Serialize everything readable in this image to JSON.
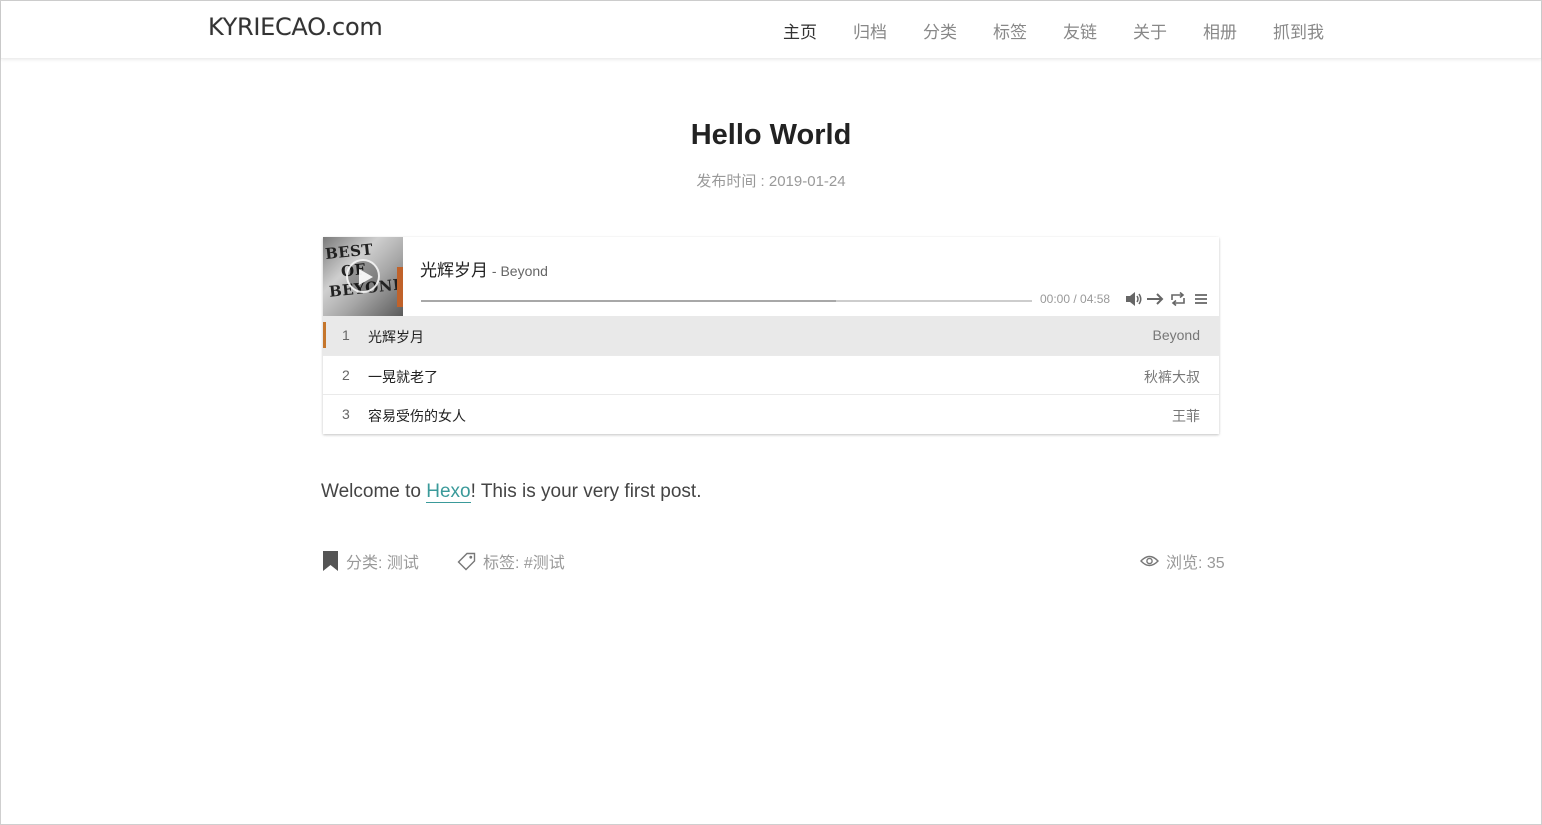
{
  "site": {
    "logo": "KYRIECAO.com"
  },
  "nav": {
    "items": [
      {
        "label": "主页",
        "active": true
      },
      {
        "label": "归档"
      },
      {
        "label": "分类"
      },
      {
        "label": "标签"
      },
      {
        "label": "友链"
      },
      {
        "label": "关于"
      },
      {
        "label": "相册"
      },
      {
        "label": "抓到我"
      }
    ]
  },
  "post": {
    "title": "Hello World",
    "meta": "发布时间 : 2019-01-24",
    "content_before": "Welcome to ",
    "content_link": "Hexo",
    "content_after": "! This is your very first post.",
    "category": "分类: 测试",
    "tags": "标签: #测试",
    "views": "浏览: 35"
  },
  "player": {
    "cover_text": [
      "BEST",
      "OF",
      "BEYOND"
    ],
    "current_song": "光辉岁月",
    "current_author": " - Beyond",
    "time": "00:00 / 04:58",
    "loaded_fraction": 0.68,
    "accent_color": "#c5762c",
    "icons": [
      "play-icon",
      "volume-icon",
      "order-icon",
      "loop-icon",
      "menu-icon"
    ],
    "playlist": [
      {
        "index": "1",
        "title": "光辉岁月",
        "artist": "Beyond",
        "active": true
      },
      {
        "index": "2",
        "title": "一晃就老了",
        "artist": "秋裤大叔"
      },
      {
        "index": "3",
        "title": "容易受伤的女人",
        "artist": "王菲"
      }
    ]
  },
  "icons": {
    "category": "bookmark-icon",
    "tags": "tag-icon",
    "views": "eye-icon"
  }
}
